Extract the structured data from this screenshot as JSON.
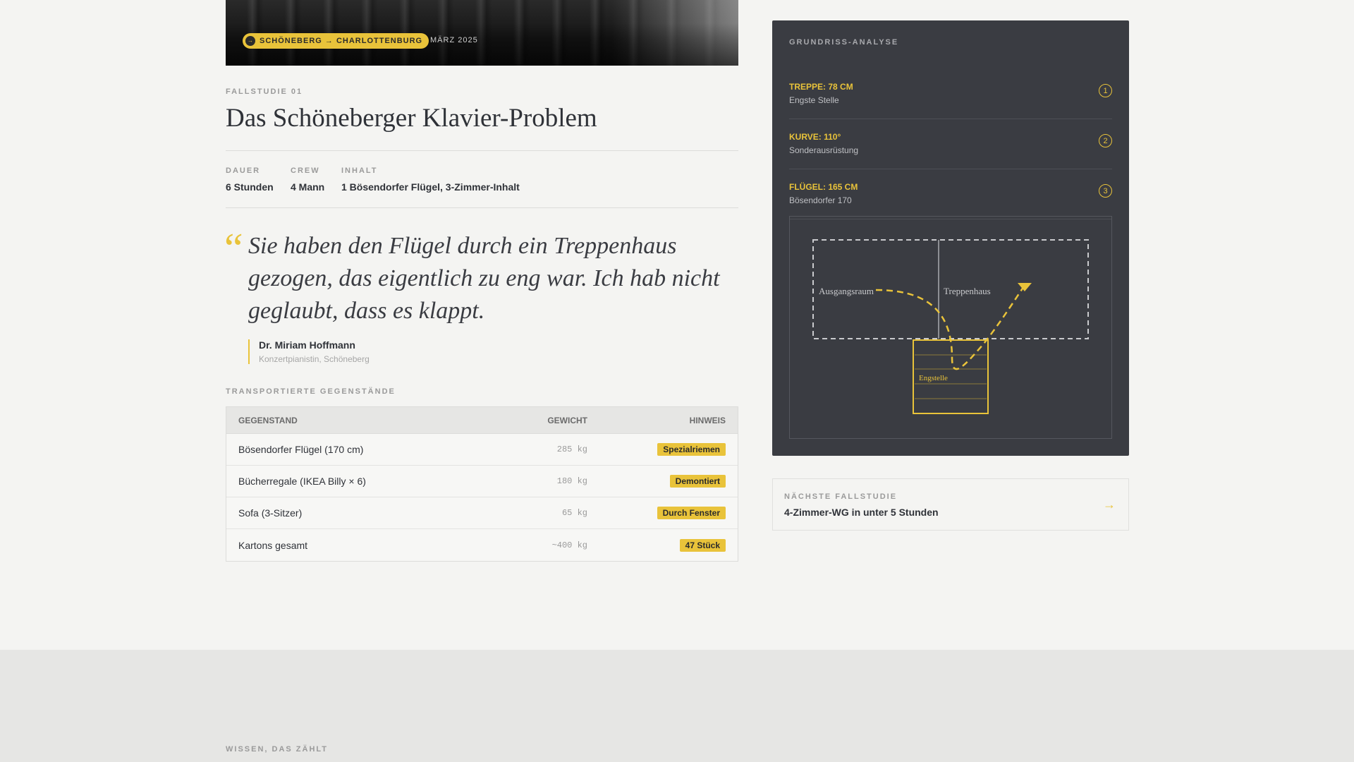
{
  "hero": {
    "route_label": "SCHÖNEBERG → CHARLOTTENBURG",
    "route_icon": "arrow-right-icon",
    "date": "MÄRZ 2025"
  },
  "case": {
    "kicker": "FALLSTUDIE 01",
    "title": "Das Schöneberger Klavier-Problem"
  },
  "meta": [
    {
      "label": "DAUER",
      "value": "6 Stunden"
    },
    {
      "label": "CREW",
      "value": "4 Mann"
    },
    {
      "label": "INHALT",
      "value": "1 Bösendorfer Flügel, 3-Zimmer-Inhalt"
    }
  ],
  "quote": {
    "mark": "“",
    "text": "Sie haben den Flügel durch ein Treppenhaus gezogen, das eigentlich zu eng war. Ich hab nicht geglaubt, dass es klappt.",
    "author": "Dr. Miriam Hoffmann",
    "role": "Konzertpianistin, Schöneberg"
  },
  "items": {
    "heading": "TRANSPORTIERTE GEGENSTÄNDE",
    "columns": [
      "GEGENSTAND",
      "GEWICHT",
      "HINWEIS"
    ],
    "rows": [
      {
        "name": "Bösendorfer Flügel (170 cm)",
        "weight": "285 kg",
        "note": "Spezialriemen"
      },
      {
        "name": "Bücherregale (IKEA Billy × 6)",
        "weight": "180 kg",
        "note": "Demontiert"
      },
      {
        "name": "Sofa (3-Sitzer)",
        "weight": "65 kg",
        "note": "Durch Fenster"
      },
      {
        "name": "Kartons gesamt",
        "weight": "~400 kg",
        "note": "47 Stück"
      }
    ]
  },
  "analysis": {
    "title": "GRUNDRISS-ANALYSE",
    "facts": [
      {
        "key": "TREPPE: 78 CM",
        "sub": "Engste Stelle",
        "num": "1"
      },
      {
        "key": "KURVE: 110°",
        "sub": "Sonderausrüstung",
        "num": "2"
      },
      {
        "key": "FLÜGEL: 165 CM",
        "sub": "Bösendorfer 170",
        "num": "3"
      }
    ],
    "plan": {
      "room_left": "Ausgangsraum",
      "room_right": "Treppenhaus",
      "bottleneck": "Engstelle"
    }
  },
  "next": {
    "kicker": "NÄCHSTE FALLSTUDIE",
    "title": "4-Zimmer-WG in unter 5 Stunden",
    "arrow": "→"
  },
  "footer": {
    "kicker": "WISSEN, DAS ZÄHLT"
  },
  "colors": {
    "accent": "#e9c33a",
    "panel": "#3a3c42",
    "background": "#f4f4f2"
  }
}
